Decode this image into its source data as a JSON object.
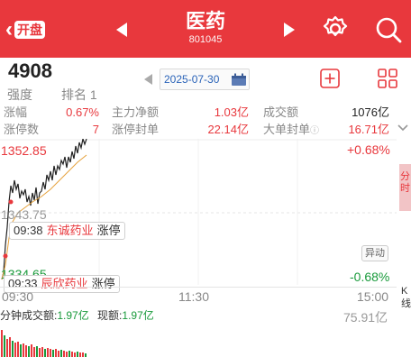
{
  "header": {
    "back_badge": "开盘",
    "title": "医药",
    "code": "801045"
  },
  "score": {
    "value": "4908",
    "strength_label": "强度",
    "rank_label": "排名 1"
  },
  "date_picker": {
    "date": "2025-07-30"
  },
  "stats": {
    "zhangfu_label": "涨幅",
    "zhangfu_value": "0.67%",
    "zhuli_label": "主力净额",
    "zhuli_value": "1.03亿",
    "chengjiao_label": "成交额",
    "chengjiao_value": "1076亿",
    "zhangting_label": "涨停数",
    "zhangting_value": "7",
    "fengdan_label": "涨停封单",
    "fengdan_value": "22.14亿",
    "dadan_label": "大单封单",
    "dadan_value": "16.71亿"
  },
  "chart": {
    "price_high": "1352.85",
    "price_mid": "1343.75",
    "price_low": "1334.65",
    "pct_high": "+0.68%",
    "pct_low": "-0.68%",
    "anomaly_label": "异动",
    "side_tab_label": "分时",
    "side_tab_2_label": "K线",
    "events": [
      {
        "time": "09:38",
        "name": "东诚药业",
        "status": "涨停"
      },
      {
        "time": "09:33",
        "name": "辰欣药业",
        "status": "涨停"
      }
    ],
    "time_labels": [
      "09:30",
      "11:30",
      "15:00"
    ]
  },
  "volume": {
    "label": "分钟成交额:",
    "value": "1.97亿",
    "now_label": "现额:",
    "now_value": "1.97亿",
    "max_value": "75.91亿"
  },
  "colors": {
    "accent": "#e8383d",
    "down": "#199a3b"
  }
}
